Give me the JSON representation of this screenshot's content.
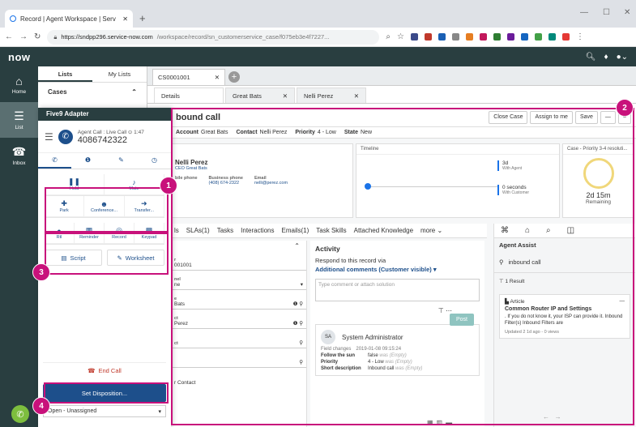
{
  "browser": {
    "tab_title": "Record | Agent Workspace | Serv",
    "url_host": "https://sndpp296.service-now.com",
    "url_path": "/workspace/record/sn_customerservice_case/f075eb3e4f7227..."
  },
  "sn": {
    "logo": "now"
  },
  "nav": {
    "items": [
      {
        "label": "Home"
      },
      {
        "label": "List"
      },
      {
        "label": "Inbox"
      }
    ]
  },
  "lists": {
    "tab_lists": "Lists",
    "tab_my_lists": "My Lists",
    "cases": "Cases"
  },
  "workspace": {
    "tab": "CS0001001",
    "subtabs": [
      "Details",
      "Great Bats",
      "Nelli Perez"
    ]
  },
  "five9": {
    "title": "Five9 Adapter",
    "status": "Agent Call : Live Call",
    "timer": "1:47",
    "number": "4086742322",
    "row1": [
      {
        "label": "Hold"
      },
      {
        "label": "Mute"
      }
    ],
    "row2": [
      {
        "label": "Park"
      },
      {
        "label": "Conference..."
      },
      {
        "label": "Transfer..."
      }
    ],
    "row3": [
      {
        "label": "Rtl"
      },
      {
        "label": "Reminder"
      },
      {
        "label": "Record"
      },
      {
        "label": "Keypad"
      }
    ],
    "script": "Script",
    "worksheet": "Worksheet",
    "end_call": "End Call",
    "set_disposition": "Set Disposition...",
    "disposition_value": "Open - Unassigned"
  },
  "record": {
    "title": "bound call",
    "account_label": "Account",
    "account": "Great Bats",
    "contact_label": "Contact",
    "contact": "Nelli Perez",
    "priority_label": "Priority",
    "priority": "4 - Low",
    "state_label": "State",
    "state": "New",
    "actions": [
      "Close Case",
      "Assign to me",
      "Save",
      "—"
    ],
    "contact_card": {
      "name": "Nelli Perez",
      "sub": "CEO  Great Bats",
      "mobile_label": "bile phone",
      "business_label": "Business phone",
      "business_value": "(408) 674-2322",
      "email_label": "Email",
      "email_value": "nelli@perez.com"
    },
    "timeline": {
      "title": "Timeline",
      "agent_value": "3d",
      "agent_label": "With Agent",
      "customer_value": "0 seconds",
      "customer_label": "With Customer"
    },
    "sla": {
      "title": "Case - Priority 3-4 resoluti...",
      "time": "2d 15m",
      "label": "Remaining"
    },
    "tabs": [
      "ls",
      "SLAs(1)",
      "Tasks",
      "Interactions",
      "Emails(1)",
      "Task Skills",
      "Attached Knowledge",
      "more"
    ],
    "fields": [
      {
        "label": "r",
        "value": "001001"
      },
      {
        "label": "nel",
        "value": "ne"
      },
      {
        "label": "e",
        "value": "Bats"
      },
      {
        "label": "ct",
        "value": "Perez"
      },
      {
        "label": "ct",
        "value": ""
      },
      {
        "label": "",
        "value": ""
      },
      {
        "label": "",
        "value": "r Contact"
      }
    ]
  },
  "activity": {
    "title": "Activity",
    "respond": "Respond to this record via",
    "mode": "Additional comments (Customer visible)",
    "placeholder": "Type comment or attach solution",
    "post": "Post",
    "entry": {
      "initials": "SA",
      "author": "System Administrator",
      "changes": "Field changes",
      "time": "2019-01-08 09:15:24",
      "rows": [
        {
          "k": "Follow the sun",
          "v": "false",
          "was": "was (Empty)"
        },
        {
          "k": "Priority",
          "v": "4 - Low",
          "was": "was (Empty)"
        },
        {
          "k": "Short description",
          "v": "Inbound call",
          "was": "was (Empty)"
        }
      ]
    }
  },
  "assist": {
    "title": "Agent Assist",
    "search": "inbound call",
    "results": "1 Result",
    "article_type": "Article",
    "article_title": "Common Router IP and Settings",
    "article_body": ". If you do not know it, your ISP can provide it. Inbound Filter(s) Inbound Filters are",
    "article_meta": "Updated 2 1d ago - 0 views"
  },
  "annotations": [
    "1",
    "2",
    "3",
    "4"
  ],
  "colors": {
    "annotation": "#c8117b",
    "nav": "#293e40",
    "primary": "#1d4f8b"
  }
}
